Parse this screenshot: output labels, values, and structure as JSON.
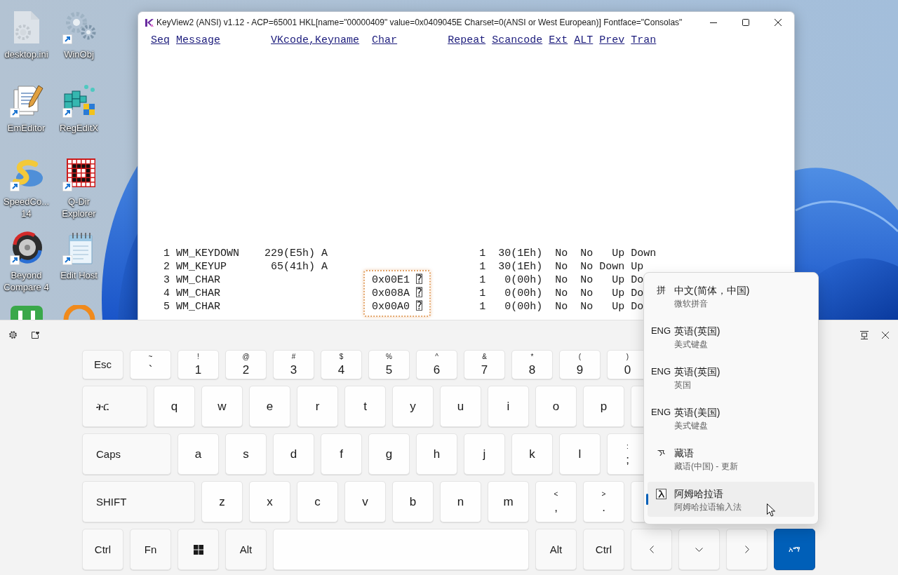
{
  "desktop": {
    "icons": [
      {
        "kind": "settings-file",
        "label": "desktop.ini",
        "shortcut": false
      },
      {
        "kind": "gears",
        "label": "WinObj",
        "shortcut": true
      },
      {
        "kind": "documents",
        "label": "EmEditor",
        "shortcut": true
      },
      {
        "kind": "cubes",
        "label": "RegEditX",
        "shortcut": true
      },
      {
        "kind": "swoosh",
        "label": "SpeedCo... 14",
        "shortcut": true
      },
      {
        "kind": "grid",
        "label": "Q-Dir Explorer",
        "shortcut": true
      },
      {
        "kind": "arrows-disc",
        "label": "Beyond Compare 4",
        "shortcut": true
      },
      {
        "kind": "notepad",
        "label": "Edit Host",
        "shortcut": true
      },
      {
        "kind": "tile"
      },
      {
        "kind": "ring"
      }
    ]
  },
  "window": {
    "title": "KeyView2 (ANSI) v1.12 - ACP=65001 HKL[name=\"00000409\" value=0x0409045E Charset=0(ANSI or West European)] Fontface=\"Consolas\"",
    "columns": [
      "Seq",
      "Message",
      "VKcode,Keyname",
      "Char",
      "Repeat",
      "Scancode",
      "Ext",
      "ALT",
      "Prev",
      "Tran"
    ],
    "rows": [
      {
        "seq": "1",
        "message": "WM_KEYDOWN",
        "vkcode": "229(E5h)",
        "keyname": "A",
        "repeat": "1",
        "scancode": "30(1Eh)",
        "ext": "No",
        "alt": "No",
        "prev": "Up",
        "tran": "Down",
        "highlighted": false
      },
      {
        "seq": "2",
        "message": "WM_KEYUP",
        "vkcode": "65(41h)",
        "keyname": "A",
        "repeat": "1",
        "scancode": "30(1Eh)",
        "ext": "No",
        "alt": "No",
        "prev": "Down",
        "tran": "Up",
        "highlighted": false
      },
      {
        "seq": "3",
        "message": "WM_CHAR",
        "char": "0x00E1 ⍰",
        "repeat": "1",
        "scancode": "0(00h)",
        "ext": "No",
        "alt": "No",
        "prev": "Up",
        "tran": "Do",
        "highlighted": true
      },
      {
        "seq": "4",
        "message": "WM_CHAR",
        "char": "0x008A ⍰",
        "repeat": "1",
        "scancode": "0(00h)",
        "ext": "No",
        "alt": "No",
        "prev": "Up",
        "tran": "Do",
        "highlighted": true
      },
      {
        "seq": "5",
        "message": "WM_CHAR",
        "char": "0x00A0 ⍰",
        "repeat": "1",
        "scancode": "0(00h)",
        "ext": "No",
        "alt": "No",
        "prev": "Up",
        "tran": "Do",
        "highlighted": true
      }
    ]
  },
  "keyboard": {
    "key_rows": [
      {
        "keys": [
          {
            "kind": "esc",
            "label": "Esc"
          },
          {
            "kind": "char",
            "label": "`",
            "shift": "~"
          },
          {
            "kind": "char",
            "label": "1",
            "shift": "!"
          },
          {
            "kind": "char",
            "label": "2",
            "shift": "@"
          },
          {
            "kind": "char",
            "label": "3",
            "shift": "#"
          },
          {
            "kind": "char",
            "label": "4",
            "shift": "$"
          },
          {
            "kind": "char",
            "label": "5",
            "shift": "%"
          },
          {
            "kind": "char",
            "label": "6",
            "shift": "^"
          },
          {
            "kind": "char",
            "label": "7",
            "shift": "&"
          },
          {
            "kind": "char",
            "label": "8",
            "shift": "*"
          },
          {
            "kind": "char",
            "label": "9",
            "shift": "("
          },
          {
            "kind": "char",
            "label": "0",
            "shift": ")"
          }
        ]
      },
      {
        "keys": [
          {
            "kind": "tab",
            "label": "ትር"
          },
          {
            "kind": "char",
            "label": "q"
          },
          {
            "kind": "char",
            "label": "w"
          },
          {
            "kind": "char",
            "label": "e"
          },
          {
            "kind": "char",
            "label": "r"
          },
          {
            "kind": "char",
            "label": "t"
          },
          {
            "kind": "char",
            "label": "y"
          },
          {
            "kind": "char",
            "label": "u"
          },
          {
            "kind": "char",
            "label": "i"
          },
          {
            "kind": "char",
            "label": "o"
          },
          {
            "kind": "char",
            "label": "p"
          },
          {
            "kind": "char"
          }
        ]
      },
      {
        "keys": [
          {
            "kind": "caps",
            "label": "Caps"
          },
          {
            "kind": "char",
            "label": "a"
          },
          {
            "kind": "char",
            "label": "s"
          },
          {
            "kind": "char",
            "label": "d"
          },
          {
            "kind": "char",
            "label": "f"
          },
          {
            "kind": "char",
            "label": "g"
          },
          {
            "kind": "char",
            "label": "h"
          },
          {
            "kind": "char",
            "label": "j"
          },
          {
            "kind": "char",
            "label": "k"
          },
          {
            "kind": "char",
            "label": "l"
          },
          {
            "kind": "char",
            "label": ";",
            "shift": ":"
          }
        ]
      },
      {
        "keys": [
          {
            "kind": "shift",
            "label": "SHIFT"
          },
          {
            "kind": "char",
            "label": "z"
          },
          {
            "kind": "char",
            "label": "x"
          },
          {
            "kind": "char",
            "label": "c"
          },
          {
            "kind": "char",
            "label": "v"
          },
          {
            "kind": "char",
            "label": "b"
          },
          {
            "kind": "char",
            "label": "n"
          },
          {
            "kind": "char",
            "label": "m"
          },
          {
            "kind": "char",
            "label": ",",
            "shift": "<"
          },
          {
            "kind": "char",
            "label": ".",
            "shift": ">"
          },
          {
            "kind": "char"
          }
        ]
      },
      {
        "keys": [
          {
            "kind": "ctrl",
            "label": "Ctrl"
          },
          {
            "kind": "fn",
            "label": "Fn"
          },
          {
            "kind": "windows"
          },
          {
            "kind": "alt",
            "label": "Alt"
          },
          {
            "kind": "space"
          },
          {
            "kind": "alt",
            "label": "Alt"
          },
          {
            "kind": "ctrl",
            "label": "Ctrl"
          },
          {
            "kind": "left"
          },
          {
            "kind": "down"
          },
          {
            "kind": "right"
          },
          {
            "kind": "language",
            "label": "አማ"
          }
        ]
      }
    ]
  },
  "language_menu": {
    "items": [
      {
        "kind": "label",
        "badge": "拼",
        "title": "中文(简体，中国)",
        "subtitle": "微软拼音",
        "selected": false
      },
      {
        "kind": "label",
        "badge": "ENG",
        "title": "英语(英国)",
        "subtitle": "美式键盘",
        "selected": false
      },
      {
        "kind": "label",
        "badge": "ENG",
        "title": "英语(英国)",
        "subtitle": "英国",
        "selected": false
      },
      {
        "kind": "label",
        "badge": "ENG",
        "title": "英语(美国)",
        "subtitle": "美式键盘",
        "selected": false
      },
      {
        "kind": "tibetan",
        "title": "藏语",
        "subtitle": "藏语(中国) - 更新",
        "selected": false
      },
      {
        "kind": "amharic",
        "title": "阿姆哈拉语",
        "subtitle": "阿姆哈拉语输入法",
        "selected": true
      }
    ]
  }
}
